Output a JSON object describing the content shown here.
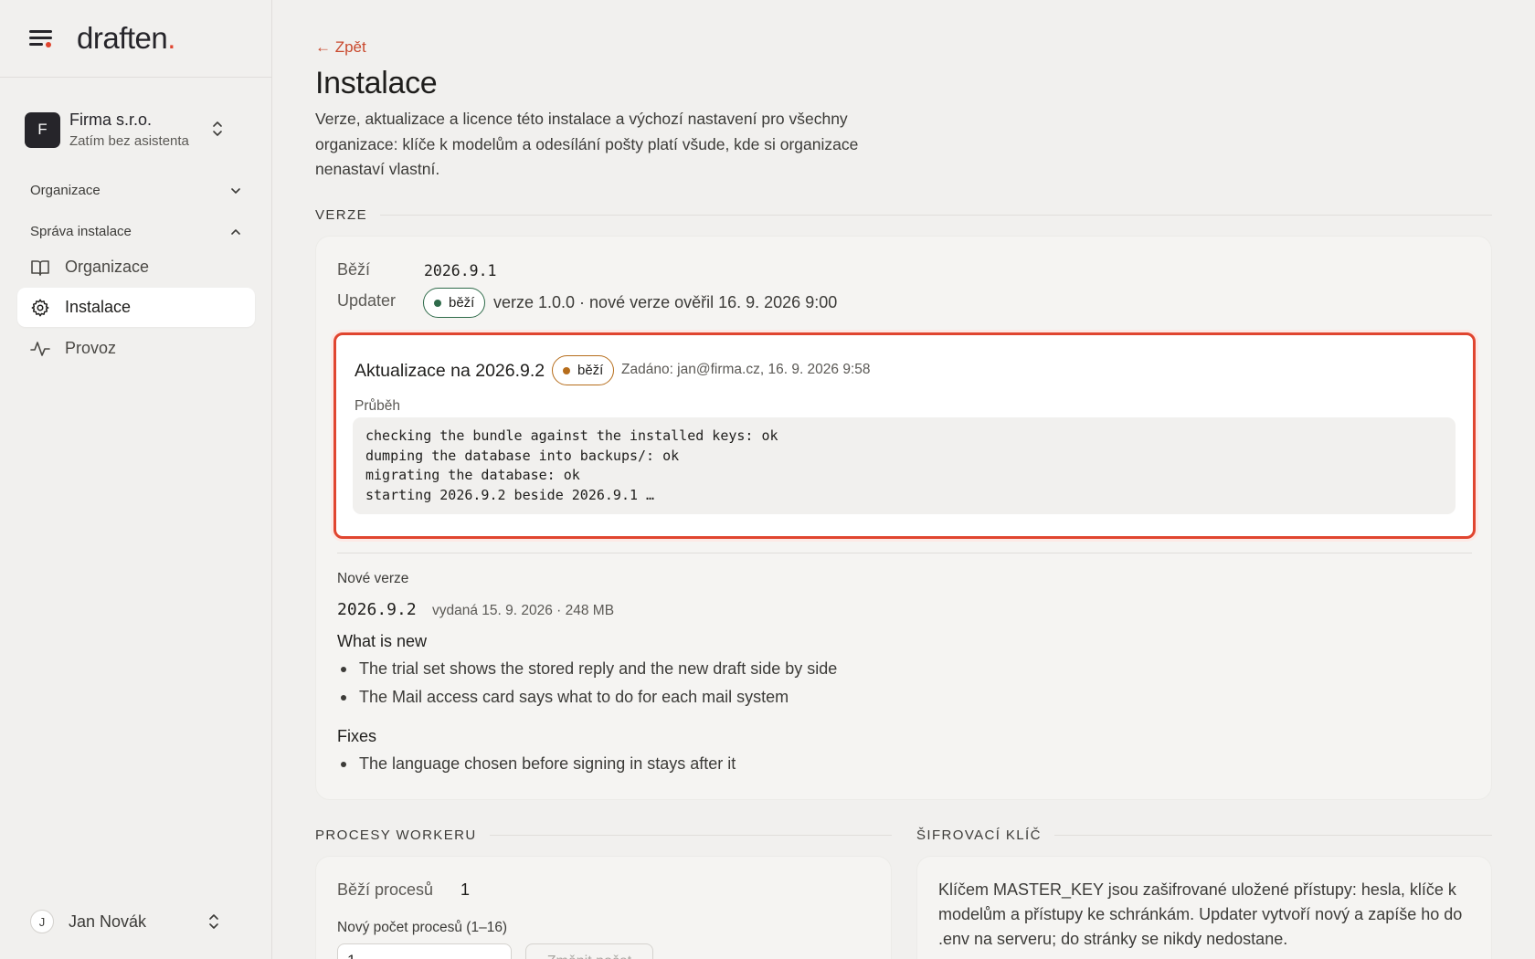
{
  "brand": {
    "logo_text": "draften",
    "logo_dot": "."
  },
  "colors": {
    "accent": "#e0452f",
    "running_green": "#2f6b4a",
    "running_amber": "#b66d1b"
  },
  "org_switcher": {
    "avatar_letter": "F",
    "name": "Firma s.r.o.",
    "subtitle": "Zatím bez asistenta"
  },
  "sidebar": {
    "group_org": "Organizace",
    "group_admin": "Správa instalace",
    "items": [
      {
        "label": "Organizace",
        "icon": "book-icon"
      },
      {
        "label": "Instalace",
        "icon": "gear-icon",
        "active": true
      },
      {
        "label": "Provoz",
        "icon": "activity-icon"
      }
    ]
  },
  "user": {
    "avatar_letter": "J",
    "name": "Jan Novák"
  },
  "page": {
    "back_label": "← Zpět",
    "title": "Instalace",
    "lead": "Verze, aktualizace a licence této instalace a výchozí nastavení pro všechny organizace: klíče k modelům a odesílání pošty platí všude, kde si organizace nenastaví vlastní."
  },
  "version": {
    "section_title": "VERZE",
    "running_label": "Běží",
    "running_value": "2026.9.1",
    "updater_label": "Updater",
    "updater_badge": "běží",
    "updater_info": "verze 1.0.0 · nové verze ověřil 16. 9. 2026 9:00",
    "job": {
      "title": "Aktualizace na 2026.9.2",
      "badge": "běží",
      "meta": "Zadáno: jan@firma.cz, 16. 9. 2026 9:58",
      "progress_label": "Průběh",
      "log": [
        "checking the bundle against the installed keys: ok",
        "dumping the database into backups/: ok",
        "migrating the database: ok",
        "starting 2026.9.2 beside 2026.9.1 …"
      ]
    },
    "new_versions_label": "Nové verze",
    "new_version": "2026.9.2",
    "new_version_meta": "vydaná 15. 9. 2026 · 248 MB",
    "whats_new_title": "What is new",
    "whats_new": [
      "The trial set shows the stored reply and the new draft side by side",
      "The Mail access card says what to do for each mail system"
    ],
    "fixes_title": "Fixes",
    "fixes": [
      "The language chosen before signing in stays after it"
    ]
  },
  "workers": {
    "section_title": "PROCESY WORKERU",
    "running_label": "Běží procesů",
    "running_value": "1",
    "new_count_label": "Nový počet procesů (1–16)",
    "input_value": "1",
    "change_button": "Změnit počet"
  },
  "encryption": {
    "section_title": "ŠIFROVACÍ KLÍČ",
    "text": "Klíčem MASTER_KEY jsou zašifrované uložené přístupy: hesla, klíče k modelům a přístupy ke schránkám. Updater vytvoří nový a zapíše ho do .env na serveru; do stránky se nikdy nedostane."
  }
}
